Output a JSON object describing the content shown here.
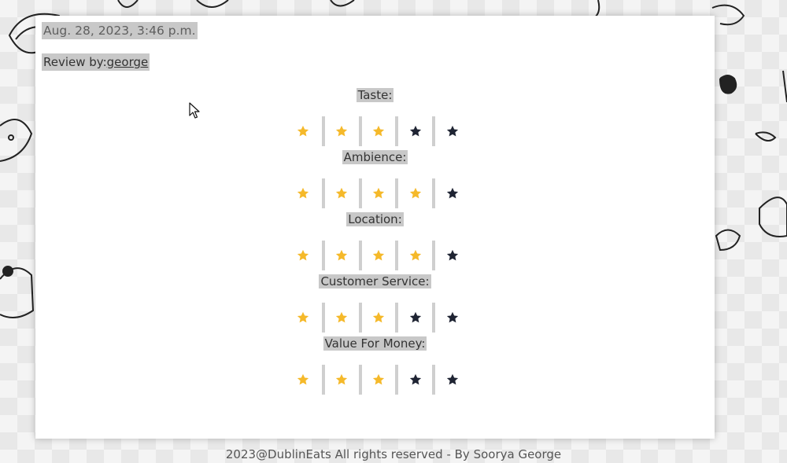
{
  "review": {
    "date": "Aug. 28, 2023, 3:46 p.m.",
    "review_by_label": "Review by:",
    "author": "george"
  },
  "ratings": [
    {
      "label": "Taste:",
      "value": 3,
      "max": 5
    },
    {
      "label": "Ambience:",
      "value": 4,
      "max": 5
    },
    {
      "label": "Location:",
      "value": 4,
      "max": 5
    },
    {
      "label": "Customer Service:",
      "value": 3,
      "max": 5
    },
    {
      "label": "Value For Money:",
      "value": 3,
      "max": 5
    }
  ],
  "colors": {
    "star_filled": "#f5b92a",
    "star_empty": "#1f2433",
    "highlight": "#c8c8c8"
  },
  "icons": {
    "star": "star-icon",
    "cursor": "mouse-cursor-icon"
  },
  "footer": {
    "text": "2023@DublinEats All rights reserved - By Soorya George"
  }
}
